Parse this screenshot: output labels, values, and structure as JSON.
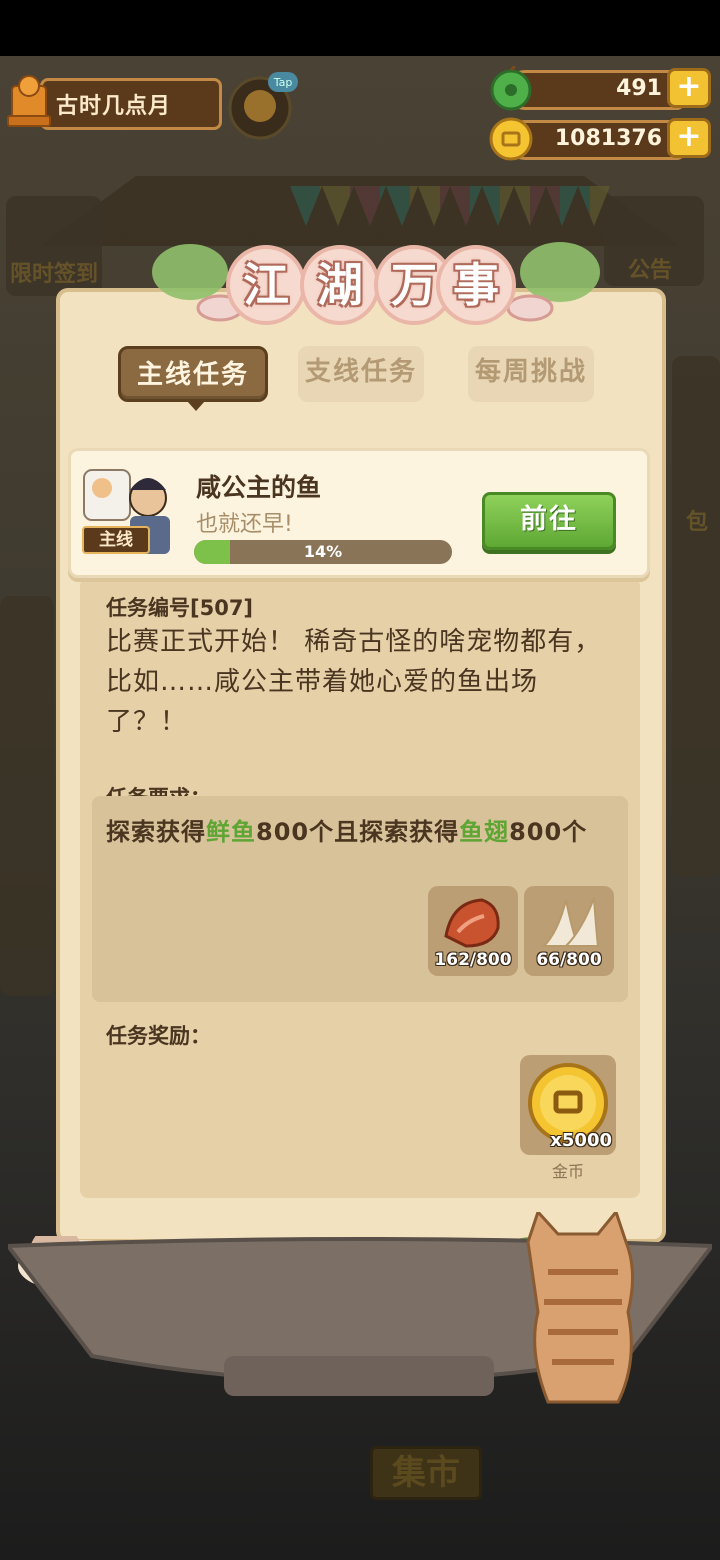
{
  "hud": {
    "player_name": "古时几点月",
    "jade": "491",
    "coins": "1081376",
    "plus": "+",
    "icons": [
      "player-avatar-icon",
      "tap-icon",
      "jade-icon",
      "coin-icon",
      "plus-icon"
    ]
  },
  "background": {
    "texts": [
      "限时签到",
      "公告",
      "集市",
      "包"
    ]
  },
  "dialog": {
    "title_chars": [
      "江",
      "湖",
      "万",
      "事"
    ],
    "tabs": [
      {
        "label": "主线任务",
        "active": true
      },
      {
        "label": "支线任务",
        "active": false
      },
      {
        "label": "每周挑战",
        "active": false
      }
    ],
    "quest": {
      "tag": "主线",
      "title": "咸公主的鱼",
      "subtitle": "也就还早!",
      "progress_percent": 14,
      "progress_label": "14%",
      "go_button": "前往"
    },
    "task_number_label": "任务编号[507]",
    "description": "比赛正式开始！ 稀奇古怪的啥宠物都有，比如……咸公主带着她心爱的鱼出场了？！",
    "requirement_label": "任务要求：",
    "requirement_parts": [
      {
        "text": "探索获得",
        "highlight": false
      },
      {
        "text": "鲜鱼",
        "highlight": true
      },
      {
        "text": "800个且探索获得",
        "highlight": false
      },
      {
        "text": "鱼翅",
        "highlight": true
      },
      {
        "text": "800个",
        "highlight": false
      }
    ],
    "requirement_items": [
      {
        "name": "fresh-fish-icon",
        "count": "162/800"
      },
      {
        "name": "shark-fin-icon",
        "count": "66/800"
      }
    ],
    "reward_label": "任务奖励：",
    "reward": {
      "icon": "gold-coin-icon",
      "count": "x5000",
      "name": "金币"
    },
    "colors": {
      "highlight": "#5fa534",
      "go_button": "#6cb83e",
      "panel": "#f2e2c0"
    }
  }
}
